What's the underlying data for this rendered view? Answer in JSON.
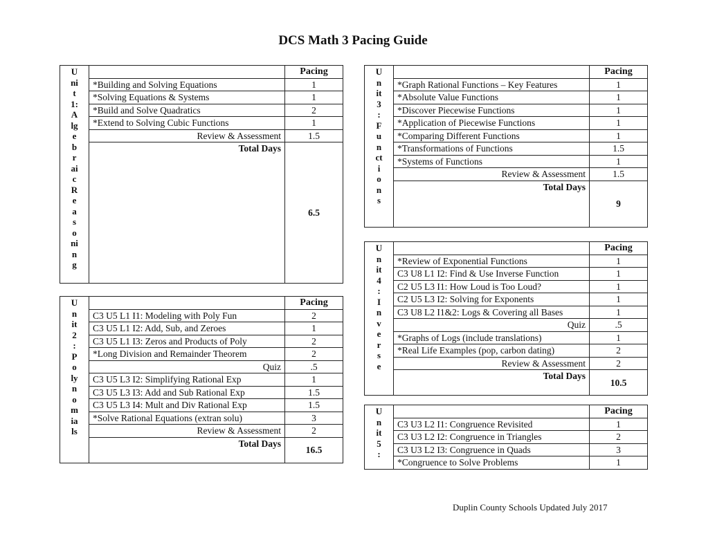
{
  "title": "DCS Math 3 Pacing Guide",
  "footer": "Duplin County Schools Updated July 2017",
  "pacing_header": "Pacing",
  "total_days_label": "Total Days",
  "units": [
    {
      "label_lines": [
        "U",
        "ni",
        "t",
        "1:",
        "A",
        "lg",
        "e",
        "b",
        "r",
        "ai",
        "c",
        "R",
        "e",
        "a",
        "s",
        "o",
        "ni",
        "n",
        "g"
      ],
      "rows": [
        {
          "topic": "*Building and Solving Equations",
          "days": "1"
        },
        {
          "topic": "*Solving Equations & Systems",
          "days": "1"
        },
        {
          "topic": "*Build and Solve Quadratics",
          "days": "2"
        },
        {
          "topic": "*Extend to Solving Cubic Functions",
          "days": "1"
        },
        {
          "topic": "Review & Assessment",
          "days": "1.5",
          "align": "right"
        }
      ],
      "total": "6.5"
    },
    {
      "label_lines": [
        "U",
        "n",
        "it",
        "2",
        ":",
        "P",
        "o",
        "ly",
        "n",
        "o",
        "m",
        "ia",
        "ls"
      ],
      "rows": [
        {
          "topic": "C3 U5 L1 I1:  Modeling with Poly Fun",
          "days": "2"
        },
        {
          "topic": "C3 U5 L1 I2:  Add, Sub, and Zeroes",
          "days": "1"
        },
        {
          "topic": "C3 U5 L1 I3:  Zeros and Products of Poly",
          "days": "2"
        },
        {
          "topic": "*Long Division and Remainder Theorem",
          "days": "2"
        },
        {
          "topic": "Quiz",
          "days": ".5",
          "align": "right"
        },
        {
          "topic": "C3 U5 L3 I2:  Simplifying Rational Exp",
          "days": "1"
        },
        {
          "topic": "C3 U5 L3 I3:  Add and Sub Rational Exp",
          "days": "1.5"
        },
        {
          "topic": "C3 U5 L3 I4:  Mult and Div Rational Exp",
          "days": "1.5"
        },
        {
          "topic": "*Solve Rational Equations (extran solu)",
          "days": "3"
        },
        {
          "topic": "Review & Assessment",
          "days": "2",
          "align": "right"
        }
      ],
      "total": "16.5"
    },
    {
      "label_lines": [
        "U",
        "n",
        "it",
        "3",
        ":",
        "F",
        "u",
        "n",
        "ct",
        "i",
        "o",
        "n",
        "s"
      ],
      "rows": [
        {
          "topic": "*Graph Rational Functions – Key Features",
          "days": "1"
        },
        {
          "topic": "*Absolute Value Functions",
          "days": "1"
        },
        {
          "topic": "*Discover Piecewise Functions",
          "days": "1"
        },
        {
          "topic": "*Application of Piecewise Functions",
          "days": "1"
        },
        {
          "topic": "*Comparing Different Functions",
          "days": "1"
        },
        {
          "topic": "*Transformations of Functions",
          "days": "1.5"
        },
        {
          "topic": "*Systems of Functions",
          "days": "1"
        },
        {
          "topic": "Review & Assessment",
          "days": "1.5",
          "align": "right"
        }
      ],
      "total": "9"
    },
    {
      "label_lines": [
        "U",
        "n",
        "it",
        "4",
        ":",
        "I",
        "n",
        "v",
        "e",
        "r",
        "s",
        "e"
      ],
      "rows": [
        {
          "topic": "*Review of Exponential Functions",
          "days": "1"
        },
        {
          "topic": "C3 U8 L1 I2: Find & Use Inverse Function",
          "days": "1"
        },
        {
          "topic": "C2 U5 L3 I1:  How Loud is Too Loud?",
          "days": "1"
        },
        {
          "topic": "C2 U5 L3 I2:  Solving for Exponents",
          "days": "1"
        },
        {
          "topic": "C3 U8 L2 I1&2:  Logs & Covering all Bases",
          "days": "1"
        },
        {
          "topic": "Quiz",
          "days": ".5",
          "align": "right"
        },
        {
          "topic": "*Graphs of Logs (include translations)",
          "days": "1"
        },
        {
          "topic": "*Real Life Examples (pop, carbon dating)",
          "days": "2"
        },
        {
          "topic": "Review & Assessment",
          "days": "2",
          "align": "right"
        }
      ],
      "total": "10.5"
    },
    {
      "label_lines": [
        "U",
        "n",
        "it",
        "5",
        ":"
      ],
      "rows": [
        {
          "topic": "C3 U3 L2 I1:  Congruence Revisited",
          "days": "1"
        },
        {
          "topic": "C3 U3 L2 I2:  Congruence in Triangles",
          "days": "2"
        },
        {
          "topic": "C3 U3 L2 I3:  Congruence in Quads",
          "days": "3"
        },
        {
          "topic": "*Congruence to Solve Problems",
          "days": "1"
        }
      ],
      "total": null
    }
  ]
}
